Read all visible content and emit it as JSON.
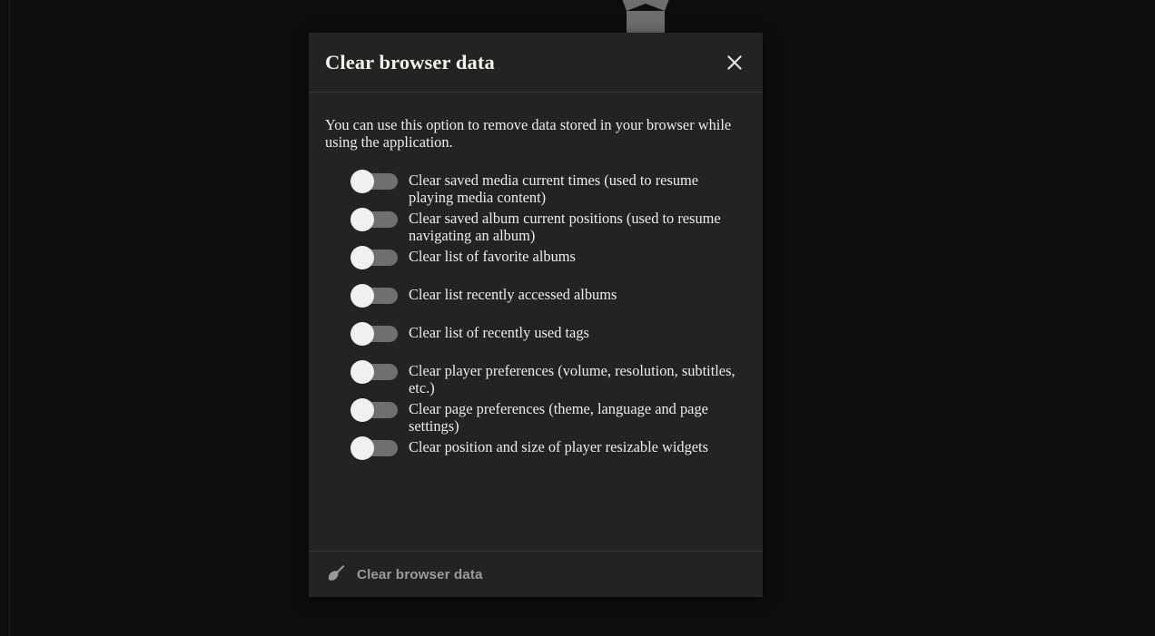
{
  "page": {
    "background_color": "#0d0d0d",
    "background_icon": "inbox-box-icon"
  },
  "dialog": {
    "title": "Clear browser data",
    "close_icon": "close-icon",
    "accent_color": "#232323",
    "divider_color": "#3a3a3a",
    "text_color": "#efece6",
    "intro": "You can use this option to remove data stored in your browser while using the application.",
    "options": [
      {
        "label": "Clear saved media current times (used to resume playing media content)",
        "enabled": false
      },
      {
        "label": "Clear saved album current positions (used to resume navigating an album)",
        "enabled": false
      },
      {
        "label": "Clear list of favorite albums",
        "enabled": false
      },
      {
        "label": "Clear list recently accessed albums",
        "enabled": false
      },
      {
        "label": "Clear list of recently used tags",
        "enabled": false
      },
      {
        "label": "Clear player preferences (volume, resolution, subtitles, etc.)",
        "enabled": false
      },
      {
        "label": "Clear page preferences (theme, language and page settings)",
        "enabled": false
      },
      {
        "label": "Clear position and size of player resizable widgets",
        "enabled": false
      }
    ],
    "footer": {
      "action_label": "Clear browser data",
      "action_icon": "broom-icon",
      "action_color": "#9b9b9b"
    }
  }
}
